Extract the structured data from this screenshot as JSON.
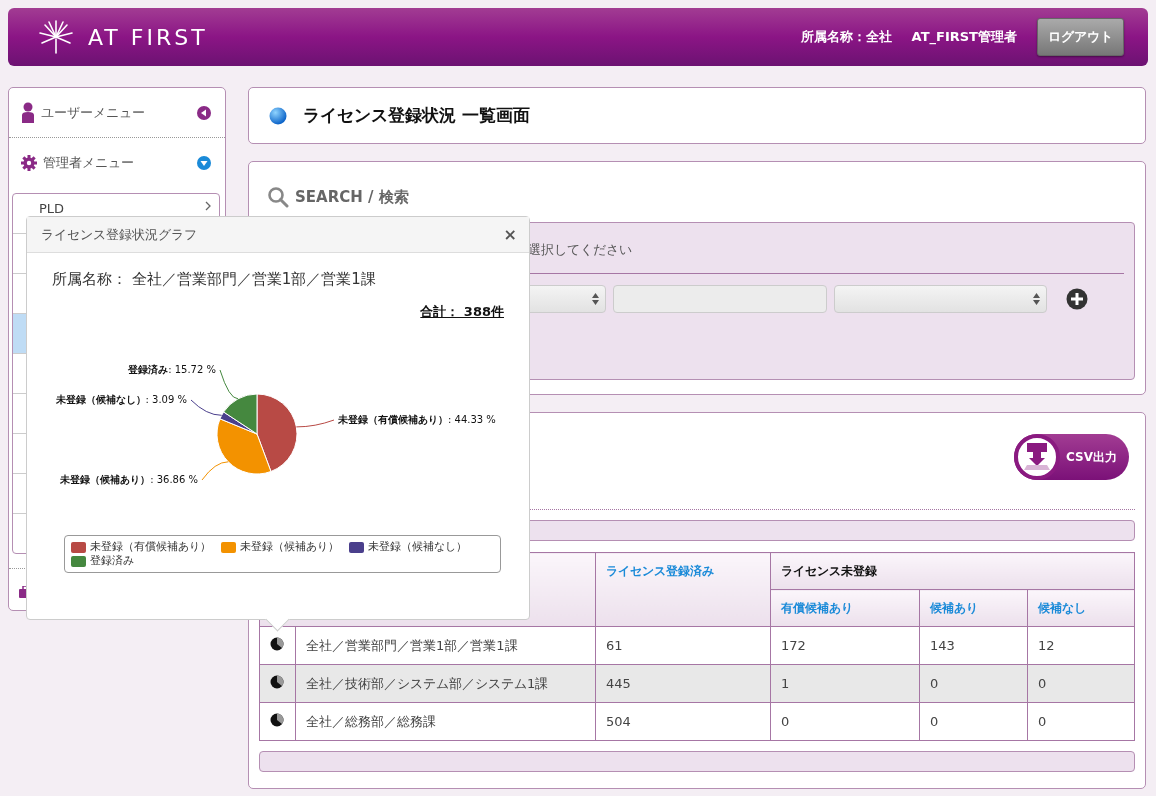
{
  "header": {
    "logo": "AT FIRST",
    "org": "所属名称：全社",
    "user": "AT_FIRST管理者",
    "logout": "ログアウト"
  },
  "sidebar": {
    "menus": [
      {
        "label": "ユーザーメニュー",
        "expanded": false
      },
      {
        "label": "管理者メニュー",
        "expanded": true
      }
    ],
    "submenu_items": [
      {
        "label": "PLD",
        "selected": false
      },
      {
        "selected": false
      },
      {
        "selected": false
      },
      {
        "selected": true
      },
      {
        "selected": false
      },
      {
        "selected": false
      },
      {
        "selected": false
      },
      {
        "selected": false
      },
      {
        "selected": false
      }
    ]
  },
  "page_title": "ライセンス登録状況 一覧画面",
  "search": {
    "title": "SEARCH / 検索",
    "prompt": "選択してください"
  },
  "csv_button": "CSV出力",
  "table": {
    "columns": {
      "registered": "ライセンス登録済み",
      "unregistered": "ライセンス未登録",
      "paid": "有償候補あり",
      "candidate": "候補あり",
      "none": "候補なし"
    },
    "rows": [
      {
        "org": "全社／営業部門／営業1部／営業1課",
        "registered": "61",
        "paid": "172",
        "candidate": "143",
        "none": "12"
      },
      {
        "org": "全社／技術部／システム部／システム1課",
        "registered": "445",
        "paid": "1",
        "candidate": "0",
        "none": "0"
      },
      {
        "org": "全社／総務部／総務課",
        "registered": "504",
        "paid": "0",
        "candidate": "0",
        "none": "0"
      }
    ]
  },
  "popup": {
    "title": "ライセンス登録状況グラフ",
    "close": "×",
    "org": "所属名称： 全社／営業部門／営業1部／営業1課",
    "total": "合計： 388件",
    "chart_data": {
      "type": "pie",
      "categories": [
        "未登録（有償候補あり）",
        "未登録（候補あり）",
        "未登録（候補なし）",
        "登録済み"
      ],
      "values": [
        44.33,
        36.86,
        3.09,
        15.72
      ],
      "value_labels": [
        "**未登録（有償候補あり）**: 44.33 %",
        "**未登録（候補あり）**: 36.86 %",
        "**未登録（候補なし）**: 3.09 %",
        "**登録済み**: 15.72 %"
      ],
      "colors": [
        "#b84a45",
        "#f39200",
        "#4a3f8c",
        "#45883f"
      ],
      "data_labels": true
    }
  }
}
